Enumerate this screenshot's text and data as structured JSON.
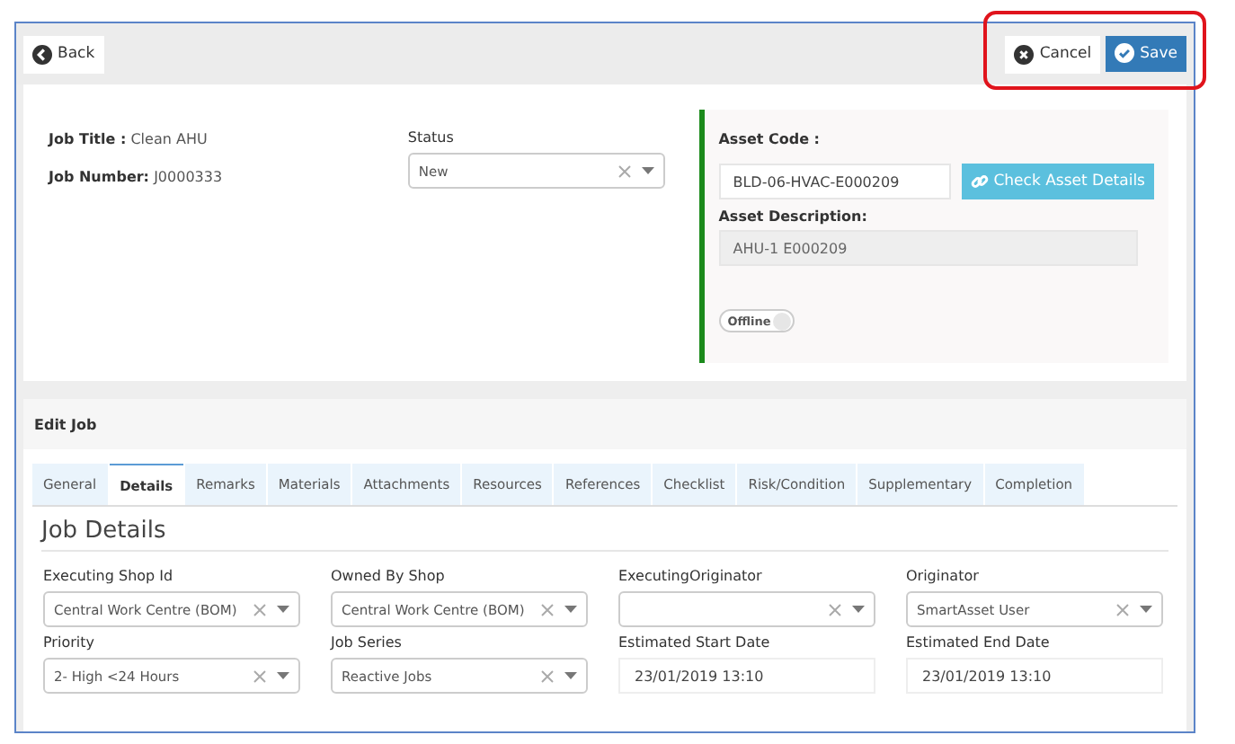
{
  "toolbar": {
    "back": "Back",
    "cancel": "Cancel",
    "save": "Save",
    "save_highlighted": true
  },
  "job": {
    "title_label": "Job Title :",
    "title": "Clean AHU",
    "number_label": "Job Number:",
    "number": "J0000333",
    "status_label": "Status",
    "status": "New"
  },
  "asset": {
    "code_label": "Asset Code :",
    "code": "BLD-06-HVAC-E000209",
    "check_button": "Check Asset Details",
    "description_label": "Asset Description:",
    "description": "AHU-1 E000209",
    "toggle_label": "Offline",
    "toggle_on": false
  },
  "section_title": "Edit Job",
  "tabs": [
    {
      "label": "General",
      "selected": false
    },
    {
      "label": "Details",
      "selected": true
    },
    {
      "label": "Remarks",
      "selected": false
    },
    {
      "label": "Materials",
      "selected": false
    },
    {
      "label": "Attachments",
      "selected": false
    },
    {
      "label": "Resources",
      "selected": false
    },
    {
      "label": "References",
      "selected": false
    },
    {
      "label": "Checklist",
      "selected": false
    },
    {
      "label": "Risk/Condition",
      "selected": false
    },
    {
      "label": "Supplementary",
      "selected": false
    },
    {
      "label": "Completion",
      "selected": false
    }
  ],
  "details_title": "Job Details",
  "fields": [
    {
      "label": "Executing Shop Id",
      "value": "Central Work Centre (BOM)",
      "kind": "select"
    },
    {
      "label": "Owned By Shop",
      "value": "Central Work Centre (BOM)",
      "kind": "select"
    },
    {
      "label": "ExecutingOriginator",
      "kind": "select"
    },
    {
      "label": "Originator",
      "value": "SmartAsset User",
      "kind": "select"
    },
    {
      "label": "Priority",
      "value": "2- High <24 Hours",
      "kind": "select"
    },
    {
      "label": "Job Series",
      "value": "Reactive Jobs",
      "kind": "select"
    },
    {
      "label": "Estimated Start Date",
      "value": "23/01/2019 13:10",
      "kind": "text"
    },
    {
      "label": "Estimated End Date",
      "value": "23/01/2019 13:10",
      "kind": "text"
    }
  ]
}
